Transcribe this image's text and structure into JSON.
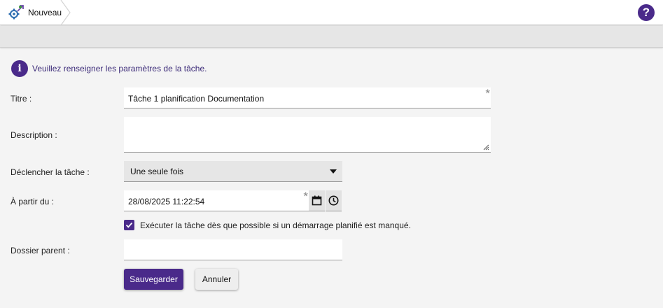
{
  "header": {
    "breadcrumb_label": "Nouveau",
    "breadcrumb_icon": "task-gear-icon",
    "help_icon": "help-icon",
    "help_glyph": "?"
  },
  "info": {
    "icon": "info-icon",
    "glyph": "i",
    "message": "Veuillez renseigner les paramètres de la tâche."
  },
  "form": {
    "title": {
      "label": "Titre :",
      "value": "Tâche 1 planification Documentation",
      "required_mark": "*"
    },
    "description": {
      "label": "Description :",
      "value": ""
    },
    "trigger": {
      "label": "Déclencher la tâche :",
      "selected": "Une seule fois"
    },
    "start": {
      "label": "À partir du :",
      "value": "28/08/2025 11:22:54",
      "required_mark": "*"
    },
    "run_missed": {
      "label": "Exécuter la tâche dès que possible si un démarrage planifié est manqué.",
      "checked": true
    },
    "parent_folder": {
      "label": "Dossier parent :",
      "value": ""
    }
  },
  "actions": {
    "save_label": "Sauvegarder",
    "cancel_label": "Annuler"
  },
  "colors": {
    "accent": "#4a2a8a",
    "info_text": "#3b2a78"
  }
}
